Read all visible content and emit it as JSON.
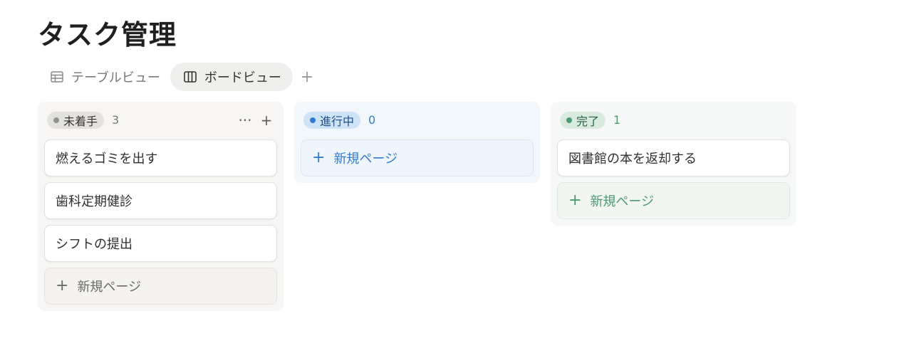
{
  "page": {
    "title": "タスク管理"
  },
  "views": {
    "table_label": "テーブルビュー",
    "board_label": "ボードビュー",
    "add_label": "+"
  },
  "columns": {
    "todo": {
      "status": "未着手",
      "count": "3",
      "more_label": "···",
      "add_label": "+",
      "cards": [
        "燃えるゴミを出す",
        "歯科定期健診",
        "シフトの提出"
      ],
      "new_page_label": "新規ページ",
      "colors": {
        "pill_bg": "#e3e2e0",
        "dot": "#91918e",
        "text": "#37352f",
        "count": "#787774"
      }
    },
    "doing": {
      "status": "進行中",
      "count": "0",
      "cards": [],
      "new_page_label": "新規ページ",
      "colors": {
        "pill_bg": "#cfe3f7",
        "dot": "#2e7dd1",
        "text": "#1f4f87",
        "count": "#2e7dd1"
      }
    },
    "done": {
      "status": "完了",
      "count": "1",
      "cards": [
        "図書館の本を返却する"
      ],
      "new_page_label": "新規ページ",
      "colors": {
        "pill_bg": "#d9ebdf",
        "dot": "#4a9b6e",
        "text": "#2b5e3f",
        "count": "#4a9b6e"
      }
    }
  },
  "icons": {
    "table_view": "table-icon",
    "board_view": "board-icon",
    "add": "plus-icon",
    "more": "more-icon"
  }
}
